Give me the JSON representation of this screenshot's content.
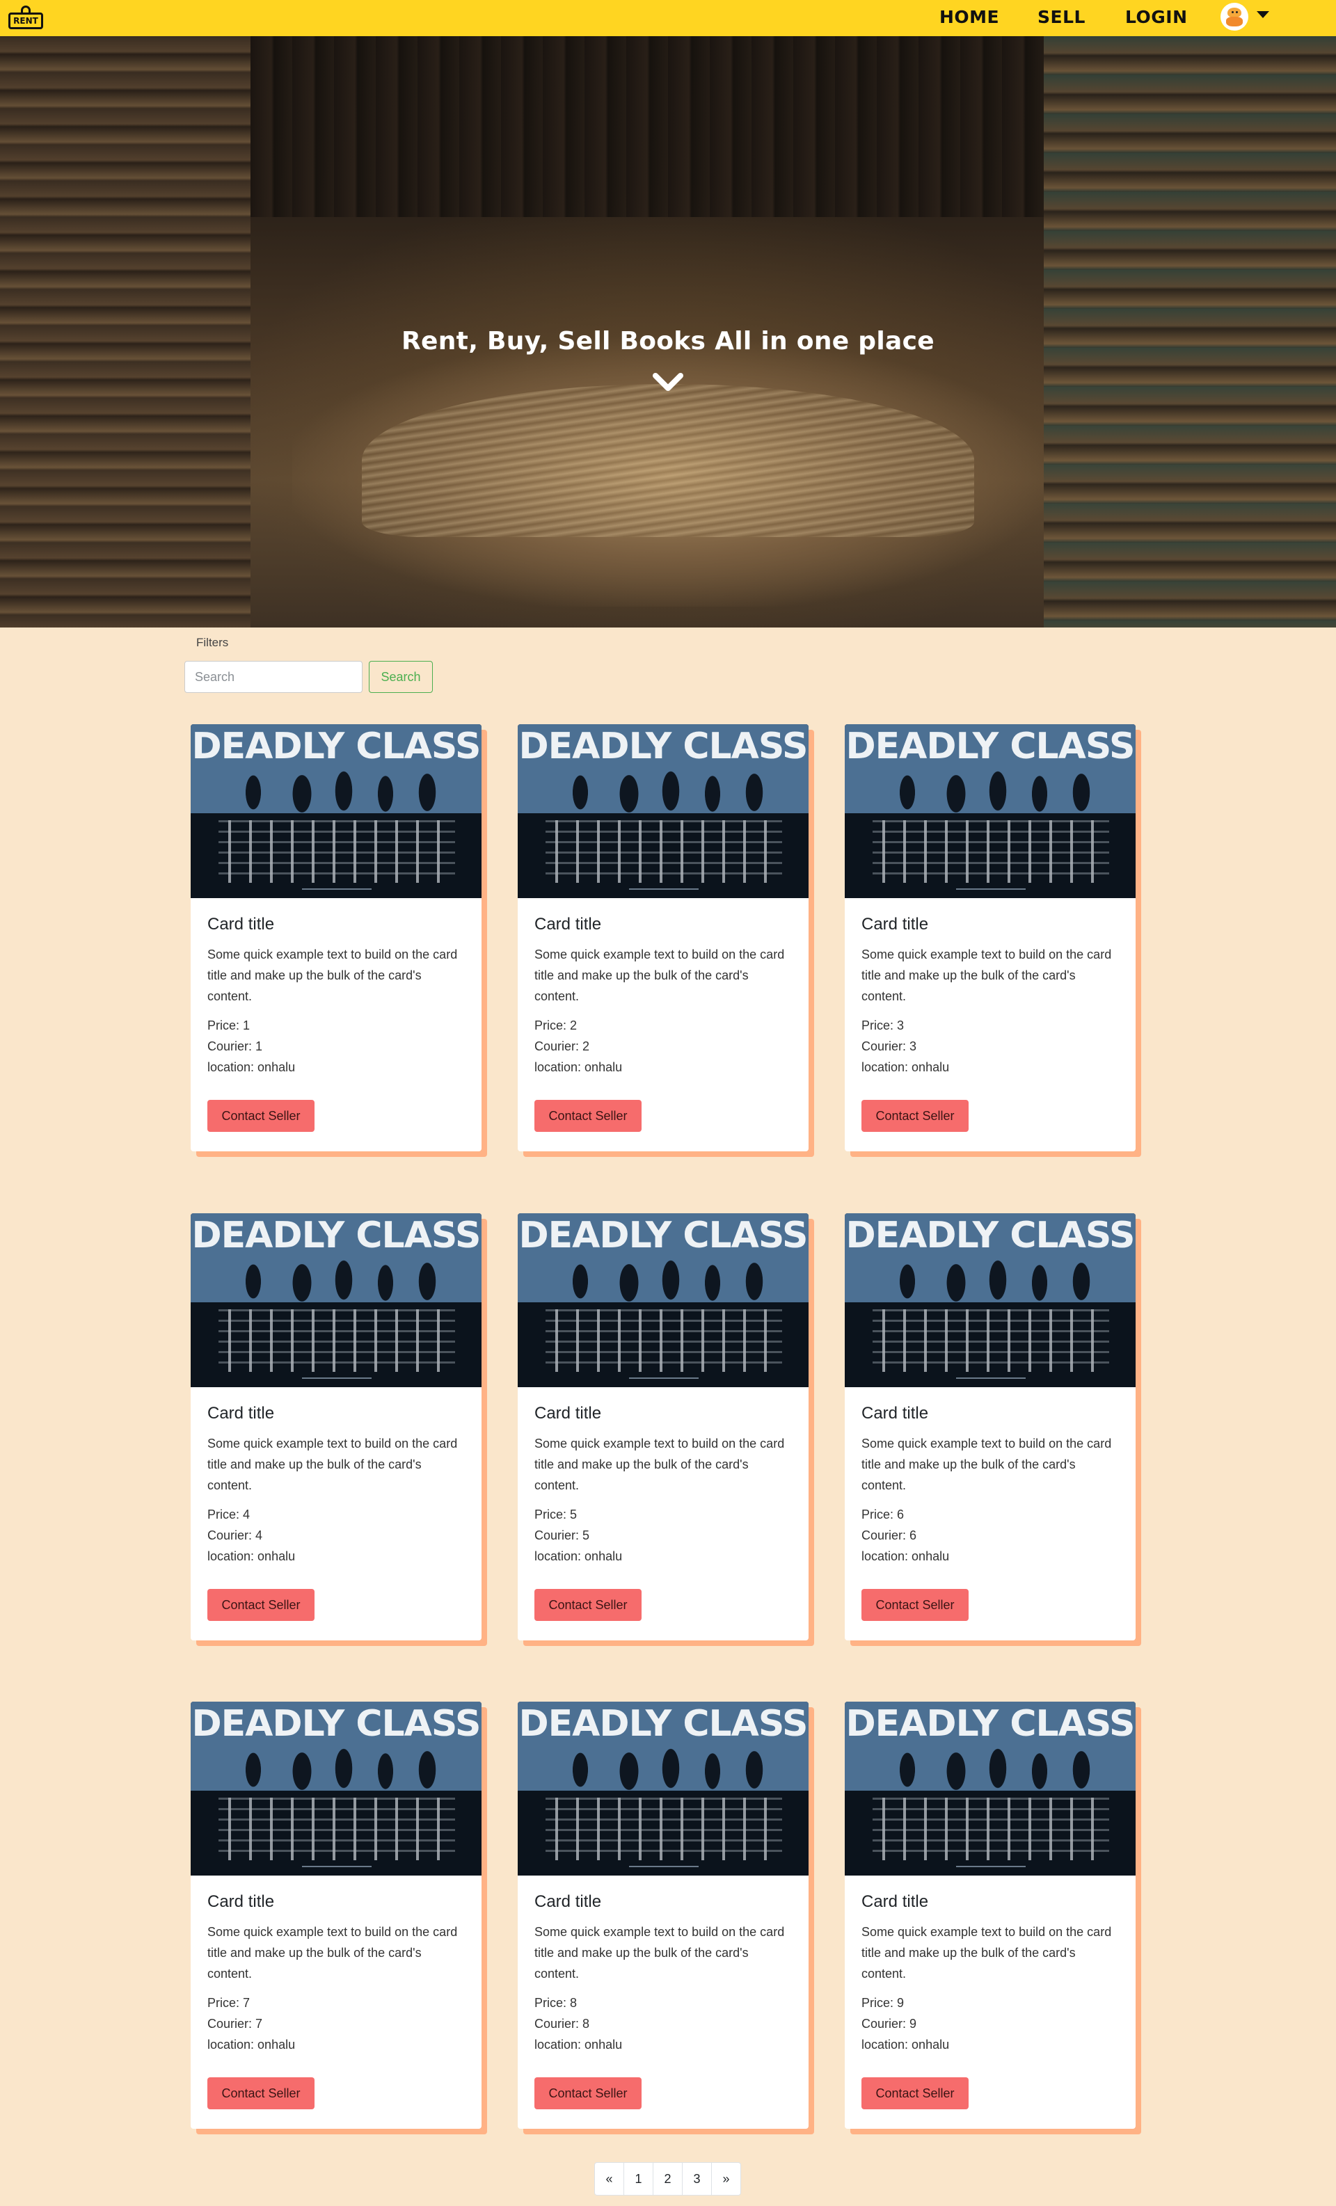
{
  "nav": {
    "logo_text": "RENT",
    "links": [
      {
        "label": "HOME"
      },
      {
        "label": "SELL"
      },
      {
        "label": "LOGIN"
      }
    ]
  },
  "hero": {
    "title": "Rent, Buy, Sell Books All in one place"
  },
  "filters": {
    "label": "Filters",
    "search_placeholder": "Search",
    "search_button": "Search"
  },
  "cards": [
    {
      "cover": "DEADLY CLASS",
      "title": "Card title",
      "text": "Some quick example text to build on the card title and make up the bulk of the card's content.",
      "price": "Price: 1",
      "courier": "Courier: 1",
      "location": "location: onhalu",
      "button": "Contact Seller"
    },
    {
      "cover": "DEADLY CLASS",
      "title": "Card title",
      "text": "Some quick example text to build on the card title and make up the bulk of the card's content.",
      "price": "Price: 2",
      "courier": "Courier: 2",
      "location": "location: onhalu",
      "button": "Contact Seller"
    },
    {
      "cover": "DEADLY CLASS",
      "title": "Card title",
      "text": "Some quick example text to build on the card title and make up the bulk of the card's content.",
      "price": "Price: 3",
      "courier": "Courier: 3",
      "location": "location: onhalu",
      "button": "Contact Seller"
    },
    {
      "cover": "DEADLY CLASS",
      "title": "Card title",
      "text": "Some quick example text to build on the card title and make up the bulk of the card's content.",
      "price": "Price: 4",
      "courier": "Courier: 4",
      "location": "location: onhalu",
      "button": "Contact Seller"
    },
    {
      "cover": "DEADLY CLASS",
      "title": "Card title",
      "text": "Some quick example text to build on the card title and make up the bulk of the card's content.",
      "price": "Price: 5",
      "courier": "Courier: 5",
      "location": "location: onhalu",
      "button": "Contact Seller"
    },
    {
      "cover": "DEADLY CLASS",
      "title": "Card title",
      "text": "Some quick example text to build on the card title and make up the bulk of the card's content.",
      "price": "Price: 6",
      "courier": "Courier: 6",
      "location": "location: onhalu",
      "button": "Contact Seller"
    },
    {
      "cover": "DEADLY CLASS",
      "title": "Card title",
      "text": "Some quick example text to build on the card title and make up the bulk of the card's content.",
      "price": "Price: 7",
      "courier": "Courier: 7",
      "location": "location: onhalu",
      "button": "Contact Seller"
    },
    {
      "cover": "DEADLY CLASS",
      "title": "Card title",
      "text": "Some quick example text to build on the card title and make up the bulk of the card's content.",
      "price": "Price: 8",
      "courier": "Courier: 8",
      "location": "location: onhalu",
      "button": "Contact Seller"
    },
    {
      "cover": "DEADLY CLASS",
      "title": "Card title",
      "text": "Some quick example text to build on the card title and make up the bulk of the card's content.",
      "price": "Price: 9",
      "courier": "Courier: 9",
      "location": "location: onhalu",
      "button": "Contact Seller"
    }
  ],
  "pagination": [
    "«",
    "1",
    "2",
    "3",
    "»"
  ],
  "icons": {
    "logo": "shopping-bag-icon",
    "avatar": "user-avatar",
    "dropdown": "caret-down-icon",
    "hero_scroll": "chevron-down-icon"
  },
  "colors": {
    "navbar": "#ffd521",
    "page_background": "#fae6cb",
    "card_shadow": "#ffb285",
    "contact_button": "#f66c6c",
    "search_button": "#4caf50"
  }
}
